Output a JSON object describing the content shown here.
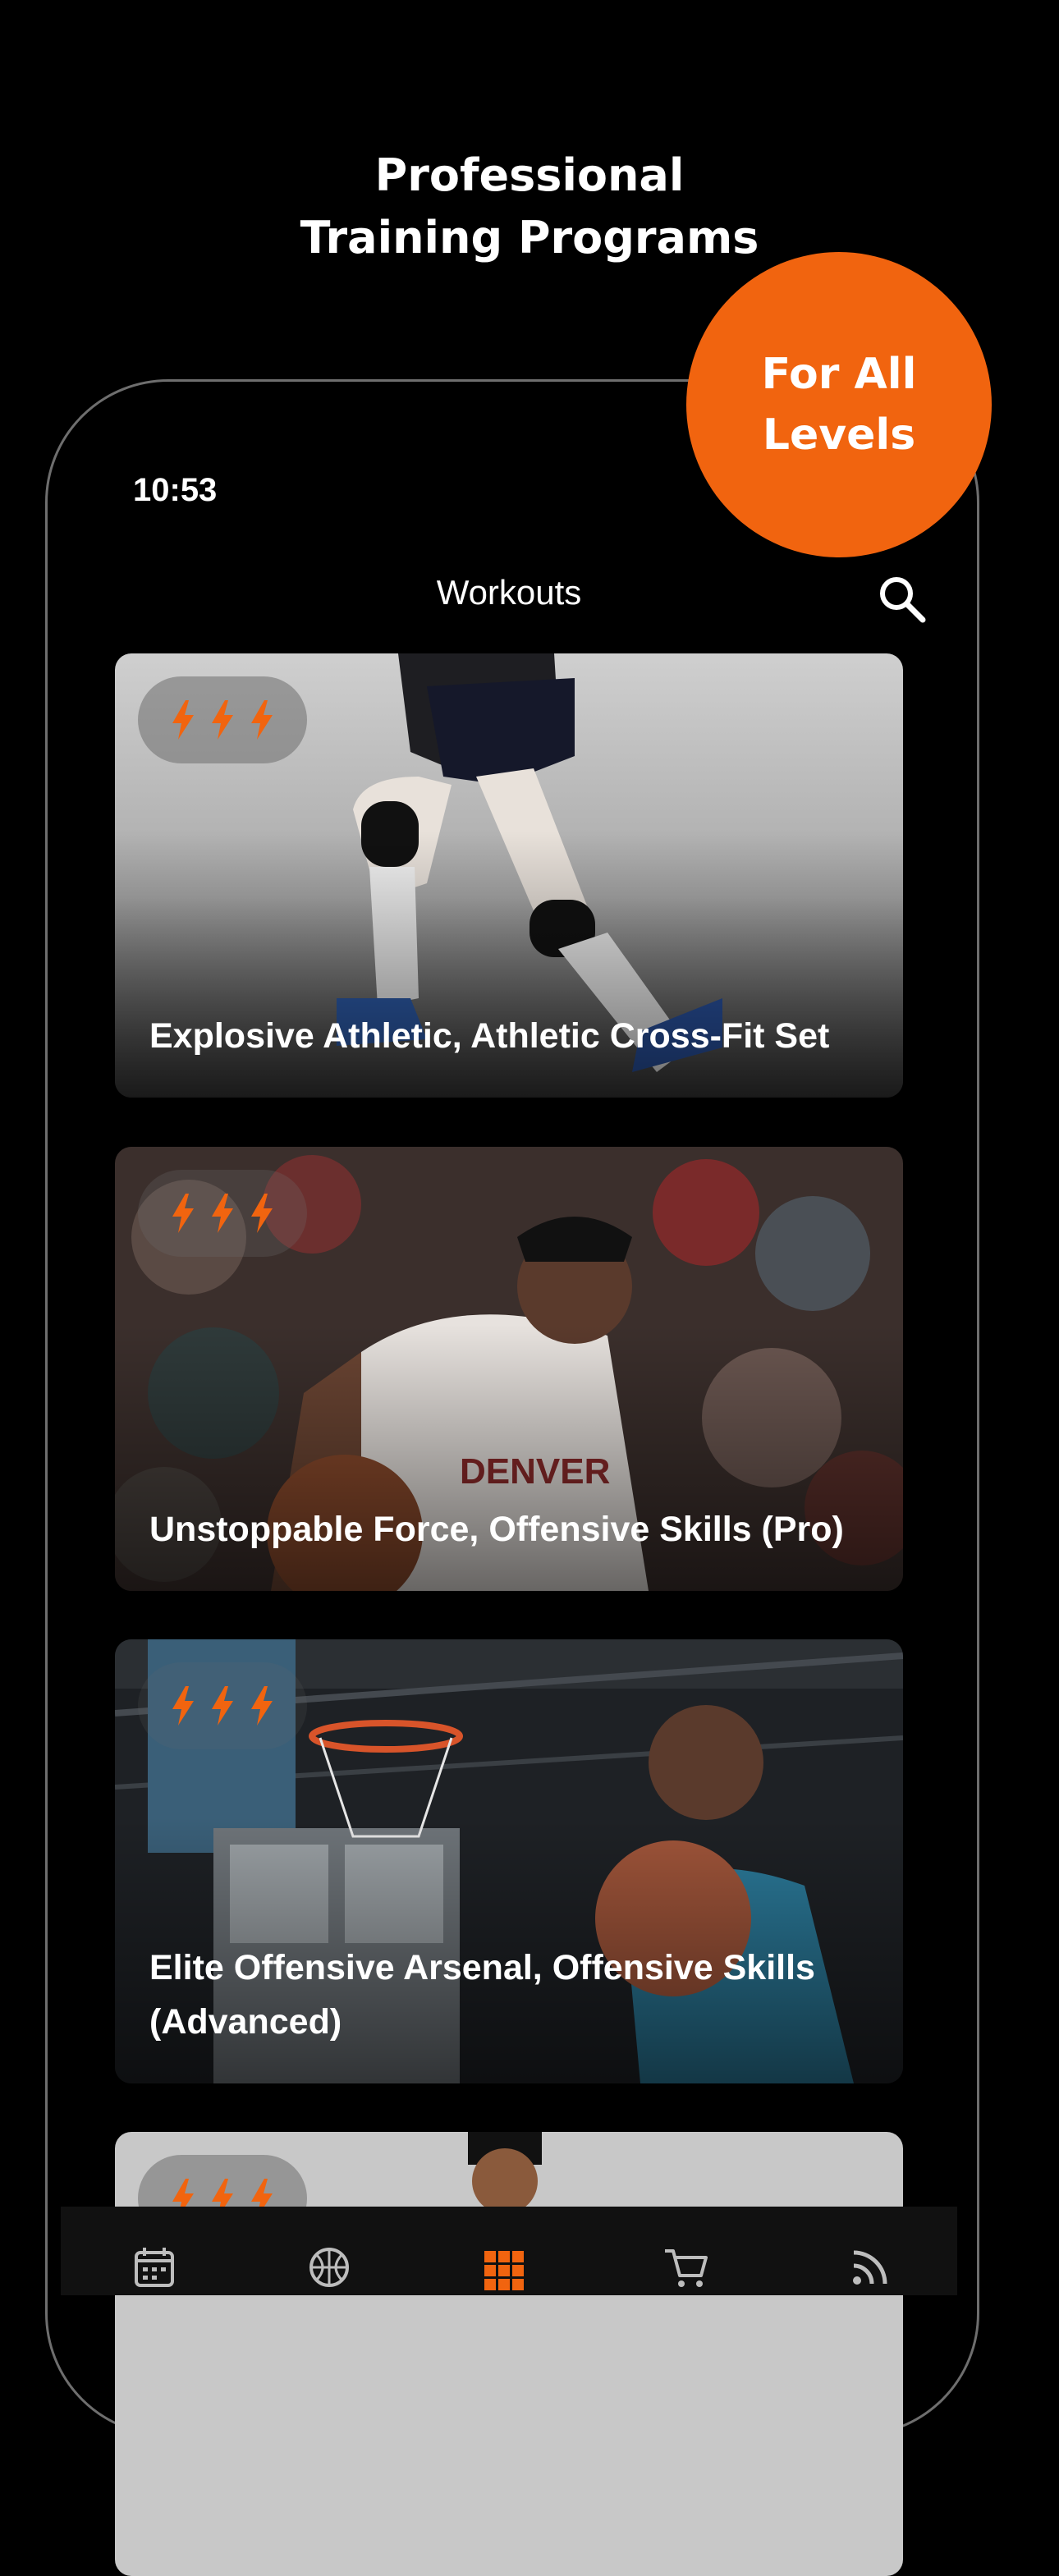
{
  "promo": {
    "headline": "Professional Training Programs",
    "badge": "For All Levels",
    "accent_color": "#f1640f"
  },
  "status_bar": {
    "time": "10:53"
  },
  "nav": {
    "title": "Workouts",
    "search_icon": "search-icon"
  },
  "workouts": [
    {
      "title": "Explosive Athletic, Athletic Cross-Fit Set",
      "level_icons": 3
    },
    {
      "title": "Unstoppable Force, Offensive Skills (Pro)",
      "level_icons": 3
    },
    {
      "title": "Elite Offensive Arsenal, Offensive Skills (Advanced)",
      "level_icons": 3
    },
    {
      "title": "",
      "level_icons": 3
    }
  ],
  "tab_bar": {
    "items": [
      {
        "icon": "calendar-icon",
        "active": false
      },
      {
        "icon": "basketball-icon",
        "active": false
      },
      {
        "icon": "grid-icon",
        "active": true
      },
      {
        "icon": "cart-icon",
        "active": false
      },
      {
        "icon": "feed-icon",
        "active": false
      }
    ]
  }
}
